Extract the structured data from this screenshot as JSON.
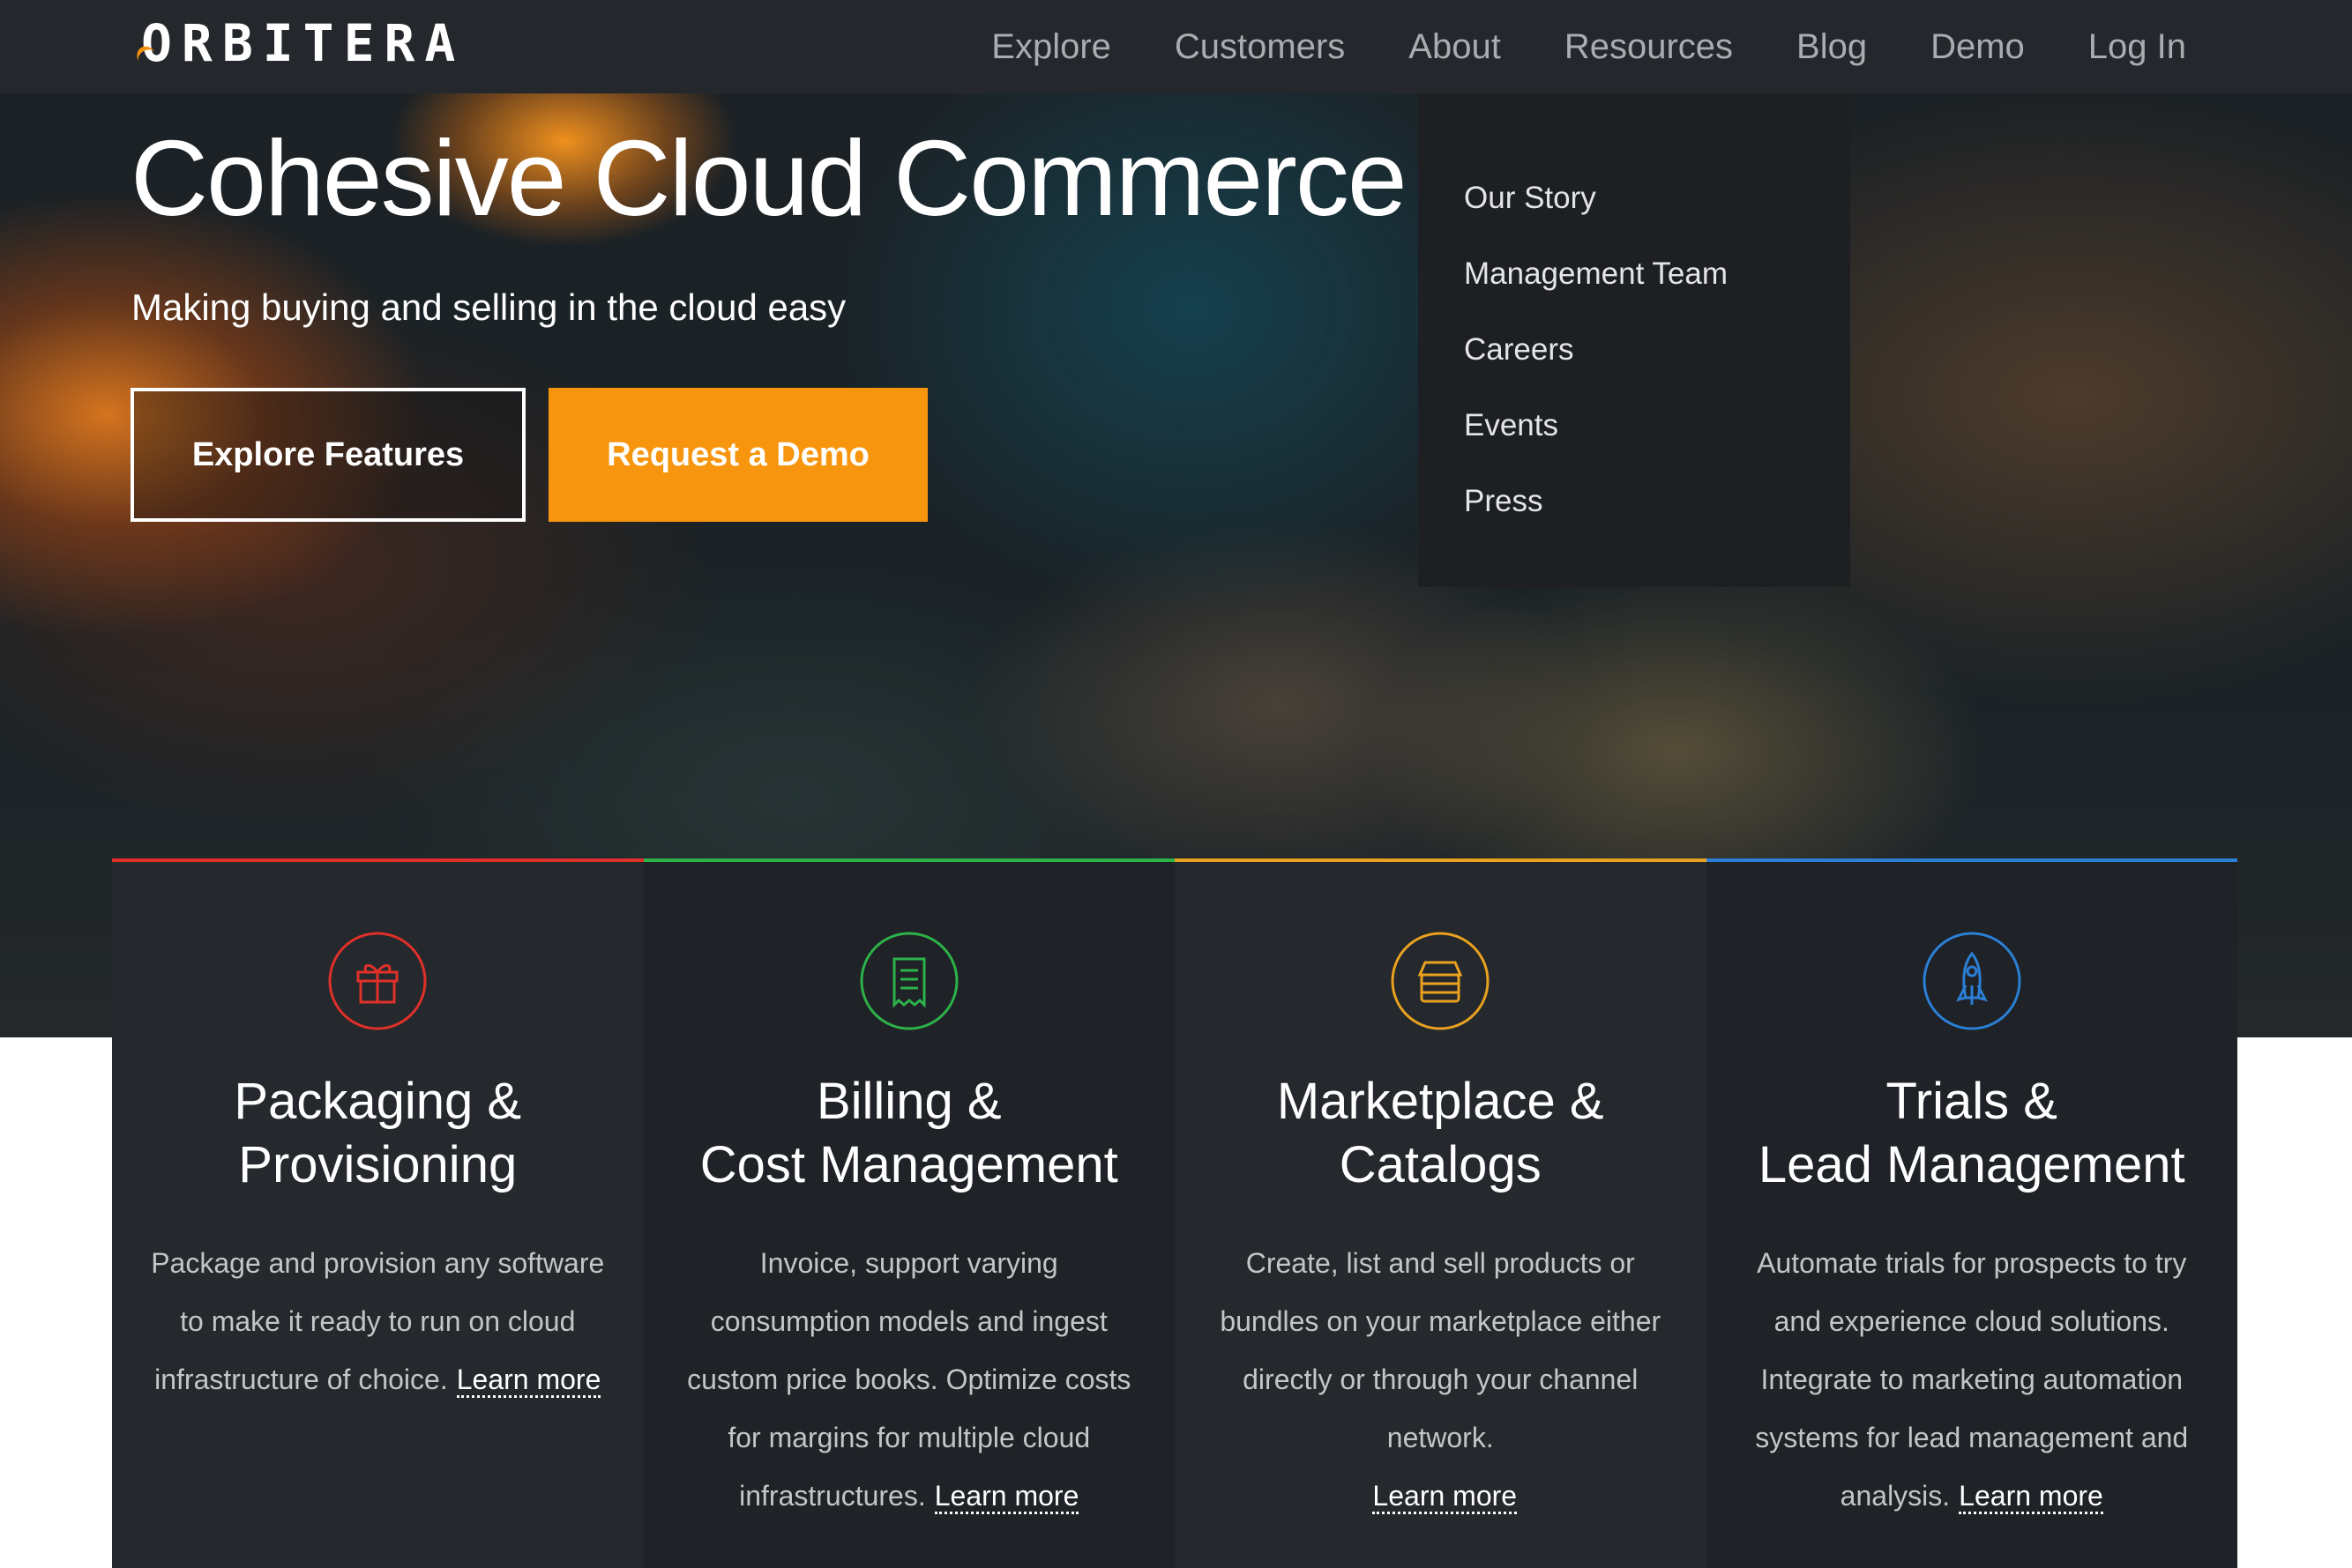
{
  "brand": {
    "logo_text": "ORBITERA",
    "accent_color": "#f7960e"
  },
  "nav": {
    "links": [
      "Explore",
      "Customers",
      "About",
      "Resources",
      "Blog",
      "Demo",
      "Log In"
    ]
  },
  "about_dropdown": {
    "items": [
      "Our Story",
      "Management Team",
      "Careers",
      "Events",
      "Press"
    ]
  },
  "hero": {
    "title": "Cohesive Cloud Commerce",
    "subtitle": "Making buying and selling in the cloud easy",
    "explore_button": "Explore Features",
    "demo_button": "Request a Demo"
  },
  "features": [
    {
      "title_line1": "Packaging &",
      "title_line2": "Provisioning",
      "description": "Package and provision any software to make it ready to run on cloud infrastructure of choice.",
      "link": "Learn more",
      "icon": "gift-icon",
      "color": "#e0302a"
    },
    {
      "title_line1": "Billing &",
      "title_line2": "Cost Management",
      "description": "Invoice, support varying consumption models and ingest custom price books. Optimize costs for margins for multiple cloud infrastructures.",
      "link": "Learn more",
      "icon": "receipt-icon",
      "color": "#2db24a"
    },
    {
      "title_line1": "Marketplace &",
      "title_line2": "Catalogs",
      "description": "Create, list and sell products or bundles on your marketplace either directly or through your channel network.",
      "link": "Learn more",
      "icon": "store-icon",
      "color": "#e9a21f"
    },
    {
      "title_line1": "Trials &",
      "title_line2": "Lead Management",
      "description": "Automate trials for prospects to try and experience cloud solutions. Integrate to marketing automation systems for lead management and analysis.",
      "link": "Learn more",
      "icon": "rocket-icon",
      "color": "#2b7fd6"
    }
  ]
}
